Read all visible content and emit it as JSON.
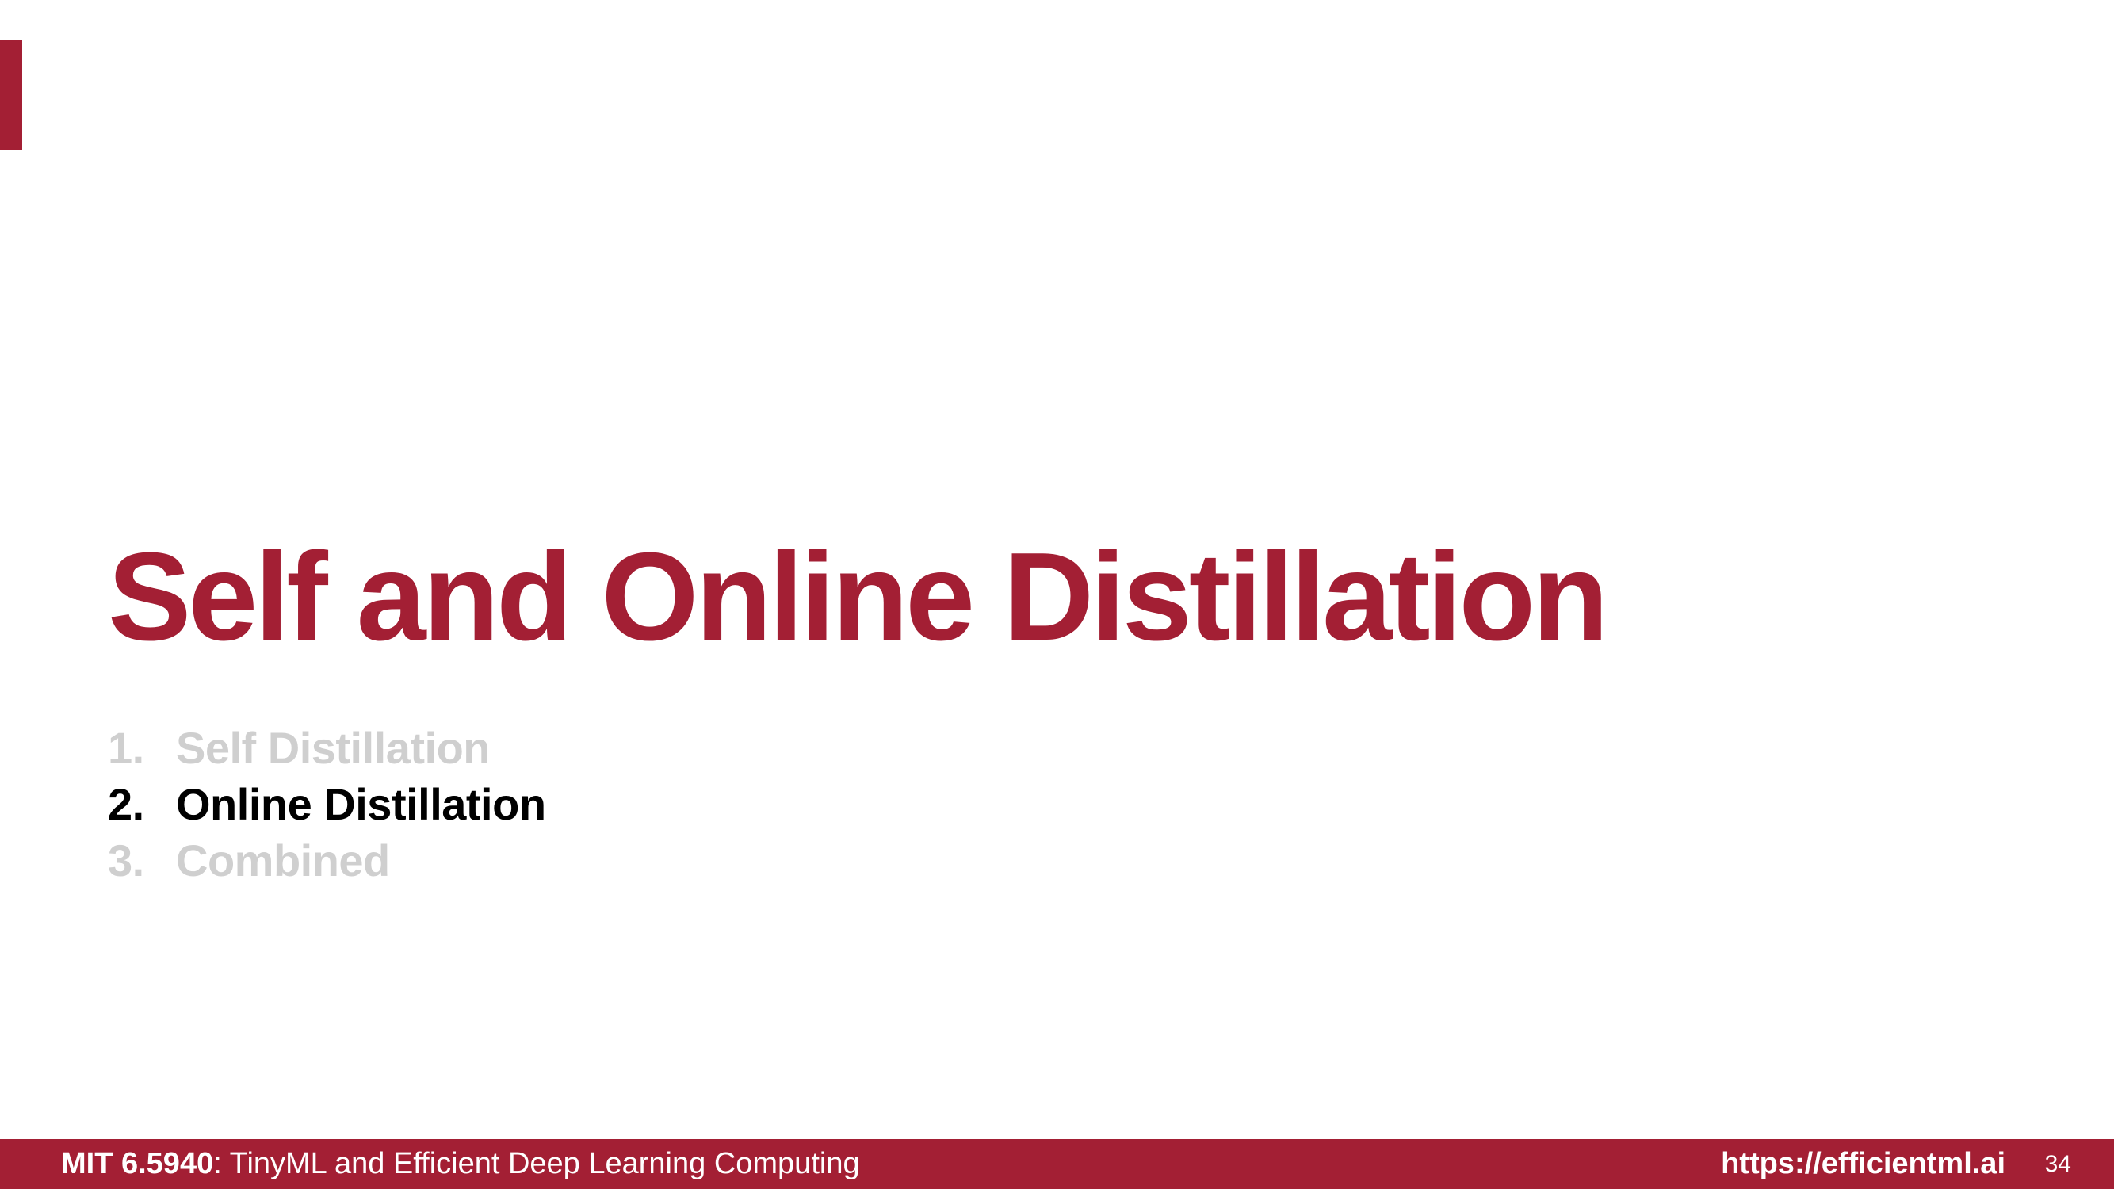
{
  "slide": {
    "title": "Self and Online Distillation",
    "agenda": [
      {
        "number": "1.",
        "label": "Self Distillation",
        "active": false
      },
      {
        "number": "2.",
        "label": "Online Distillation",
        "active": true
      },
      {
        "number": "3.",
        "label": "Combined",
        "active": false
      }
    ]
  },
  "footer": {
    "course_code": "MIT 6.5940",
    "course_title": ": TinyML and Efficient Deep Learning Computing",
    "url": "https://efficientml.ai",
    "page_number": "34"
  },
  "colors": {
    "accent": "#A31F34",
    "inactive_text": "#CFCFCF",
    "active_text": "#000000"
  }
}
